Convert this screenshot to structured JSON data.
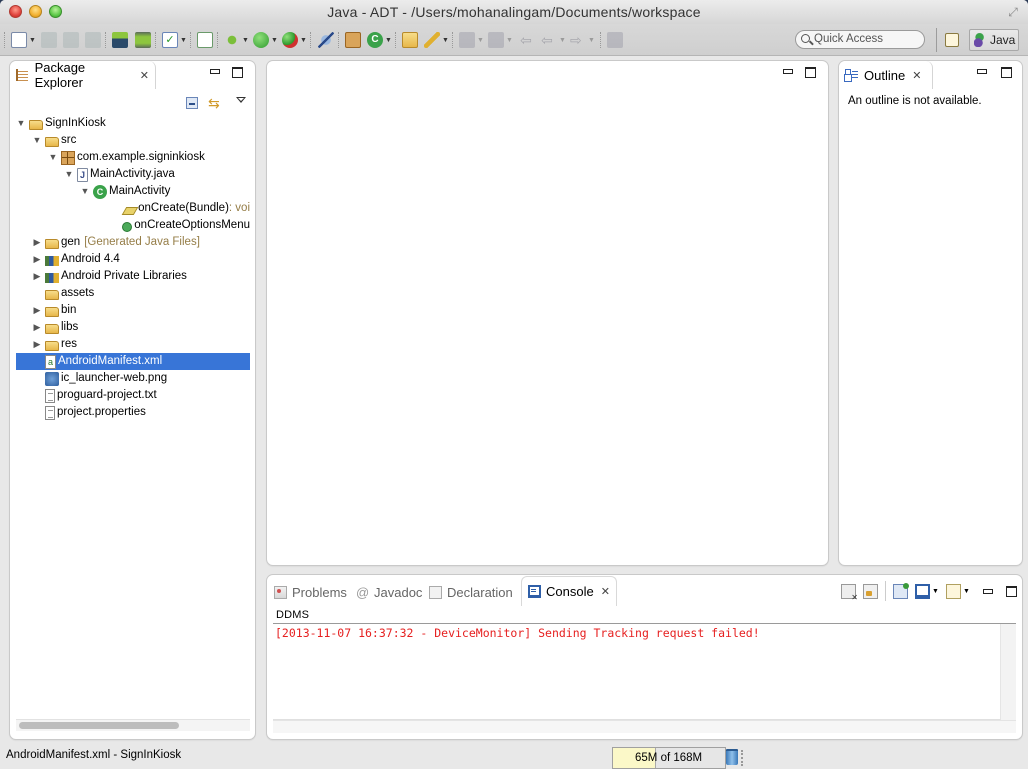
{
  "window": {
    "title": "Java - ADT - /Users/mohanalingam/Documents/workspace"
  },
  "toolbar": {
    "buttons": [
      {
        "name": "new-wizard",
        "icon": "new-icon",
        "has_dropdown": true,
        "enabled": true
      },
      {
        "name": "save",
        "icon": "save-icon",
        "enabled": false
      },
      {
        "name": "save-all",
        "icon": "save-all-icon",
        "enabled": false
      },
      {
        "name": "print",
        "icon": "print-icon",
        "enabled": false
      },
      {
        "name": "android-sdk-manager",
        "icon": "android-sdk-icon",
        "enabled": true
      },
      {
        "name": "android-avd-manager",
        "icon": "android-avd-icon",
        "enabled": true
      },
      {
        "name": "lint-check",
        "icon": "checkbox-icon",
        "has_dropdown": true,
        "enabled": true
      },
      {
        "name": "new-android-xml",
        "icon": "new-xml-icon",
        "enabled": true
      },
      {
        "name": "debug",
        "icon": "bug-icon",
        "has_dropdown": true,
        "enabled": true
      },
      {
        "name": "run",
        "icon": "run-icon",
        "has_dropdown": true,
        "enabled": true
      },
      {
        "name": "external-tools",
        "icon": "external-tools-icon",
        "has_dropdown": true,
        "enabled": true
      },
      {
        "name": "skip-breakpoints",
        "icon": "skip-breakpoints-icon",
        "enabled": true
      },
      {
        "name": "new-java-package",
        "icon": "new-package-icon",
        "enabled": true
      },
      {
        "name": "new-java-class",
        "icon": "new-class-icon",
        "has_dropdown": true,
        "enabled": true
      },
      {
        "name": "open-type",
        "icon": "open-type-icon",
        "enabled": true
      },
      {
        "name": "search",
        "icon": "search-brush-icon",
        "has_dropdown": true,
        "enabled": true
      },
      {
        "name": "next-annotation",
        "icon": "next-annotation-icon",
        "has_dropdown": true,
        "enabled": false
      },
      {
        "name": "prev-annotation",
        "icon": "prev-annotation-icon",
        "has_dropdown": true,
        "enabled": false
      },
      {
        "name": "last-edit",
        "icon": "last-edit-icon",
        "enabled": false
      },
      {
        "name": "back",
        "icon": "back-arrow-icon",
        "has_dropdown": true,
        "enabled": false
      },
      {
        "name": "forward",
        "icon": "forward-arrow-icon",
        "has_dropdown": true,
        "enabled": false
      },
      {
        "name": "pin-editor",
        "icon": "pin-editor-icon",
        "enabled": false
      }
    ],
    "quick_access_placeholder": "Quick Access",
    "perspective_label": "Java"
  },
  "package_explorer": {
    "tab_label": "Package Explorer",
    "tree": [
      {
        "label": "SignInKiosk",
        "depth": 0,
        "twisty": "expanded",
        "icon": "android-project-icon"
      },
      {
        "label": "src",
        "depth": 1,
        "twisty": "expanded",
        "icon": "source-folder-icon"
      },
      {
        "label": "com.example.signinkiosk",
        "depth": 2,
        "twisty": "expanded",
        "icon": "package-icon"
      },
      {
        "label": "MainActivity.java",
        "depth": 3,
        "twisty": "expanded",
        "icon": "java-file-icon"
      },
      {
        "label": "MainActivity",
        "depth": 4,
        "twisty": "expanded",
        "icon": "class-icon"
      },
      {
        "label": "onCreate(Bundle)",
        "suffix": " : voi",
        "depth": 6,
        "twisty": "none",
        "icon": "protected-method-icon"
      },
      {
        "label": "onCreateOptionsMenu",
        "depth": 6,
        "twisty": "none",
        "icon": "public-method-icon"
      },
      {
        "label": "gen",
        "suffix": "[Generated Java Files]",
        "depth": 1,
        "twisty": "collapsed",
        "icon": "gen-folder-icon"
      },
      {
        "label": "Android 4.4",
        "depth": 1,
        "twisty": "collapsed",
        "icon": "library-icon"
      },
      {
        "label": "Android Private Libraries",
        "depth": 1,
        "twisty": "collapsed",
        "icon": "library-icon"
      },
      {
        "label": "assets",
        "depth": 1,
        "twisty": "none",
        "icon": "folder-icon"
      },
      {
        "label": "bin",
        "depth": 1,
        "twisty": "collapsed",
        "icon": "folder-icon"
      },
      {
        "label": "libs",
        "depth": 1,
        "twisty": "collapsed",
        "icon": "folder-icon"
      },
      {
        "label": "res",
        "depth": 1,
        "twisty": "collapsed",
        "icon": "folder-icon"
      },
      {
        "label": "AndroidManifest.xml",
        "depth": 1,
        "twisty": "none",
        "icon": "xml-file-icon",
        "selected": true
      },
      {
        "label": "ic_launcher-web.png",
        "depth": 1,
        "twisty": "none",
        "icon": "image-file-icon"
      },
      {
        "label": "proguard-project.txt",
        "depth": 1,
        "twisty": "none",
        "icon": "text-file-icon"
      },
      {
        "label": "project.properties",
        "depth": 1,
        "twisty": "none",
        "icon": "text-file-icon"
      }
    ]
  },
  "outline": {
    "tab_label": "Outline",
    "message": "An outline is not available."
  },
  "console_panel": {
    "tabs": [
      {
        "label": "Problems",
        "active": false
      },
      {
        "label": "Javadoc",
        "active": false
      },
      {
        "label": "Declaration",
        "active": false
      },
      {
        "label": "Console",
        "active": true
      }
    ],
    "console_name": "DDMS",
    "lines": [
      "[2013-11-07 16:37:32 - DeviceMonitor] Sending Tracking request failed!"
    ],
    "error_color": "#e62020"
  },
  "status_bar": {
    "message": "AndroidManifest.xml - SignInKiosk",
    "heap_used": "65M",
    "heap_total": "168M",
    "heap_text": "65M of 168M",
    "heap_fraction": 0.387
  },
  "colors": {
    "selection": "#3875d7",
    "heap_fill": "#fbf8c8"
  }
}
